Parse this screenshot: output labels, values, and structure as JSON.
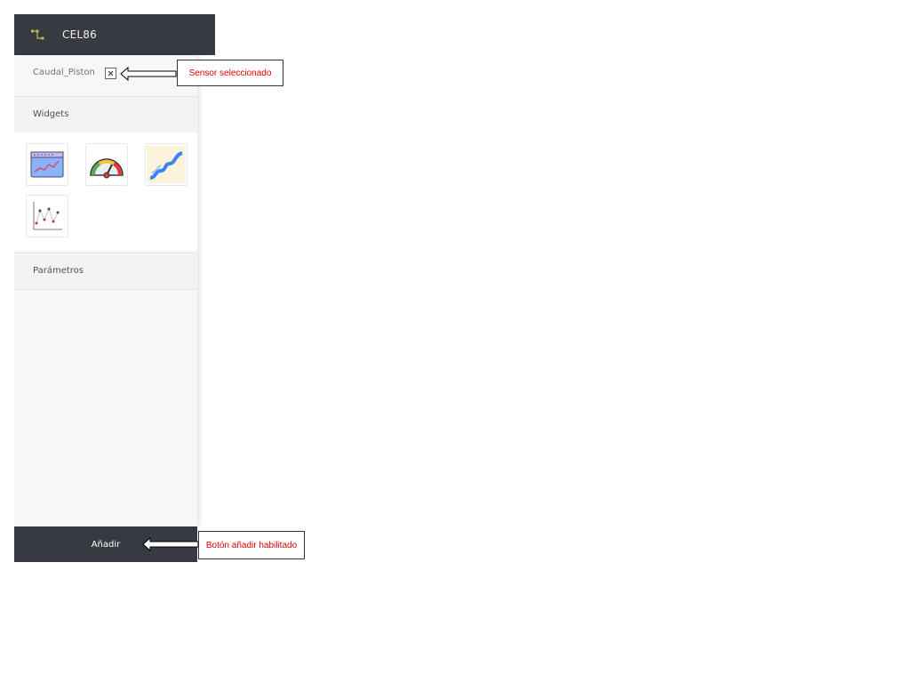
{
  "header": {
    "title": "CEL86",
    "icon": "sensor-network-icon"
  },
  "sensor": {
    "selected": "Caudal_Piston",
    "clear_icon": "close-icon"
  },
  "sections": {
    "widgets": "Widgets",
    "parameters": "Parámetros"
  },
  "widgets": [
    {
      "name": "line-chart-widget",
      "icon": "line-chart-icon"
    },
    {
      "name": "gauge-widget",
      "icon": "gauge-icon"
    },
    {
      "name": "area-wave-widget",
      "icon": "wave-chart-icon"
    },
    {
      "name": "scatter-plot-widget",
      "icon": "scatter-chart-icon"
    }
  ],
  "add_button": {
    "label": "Añadir"
  },
  "annotations": {
    "sensor": "Sensor seleccionado",
    "add_button": "Botón añadir habilitado"
  },
  "colors": {
    "dark_bar": "#373a40",
    "panel_bg": "#f6f7f9",
    "annotation_text": "#e00000"
  }
}
